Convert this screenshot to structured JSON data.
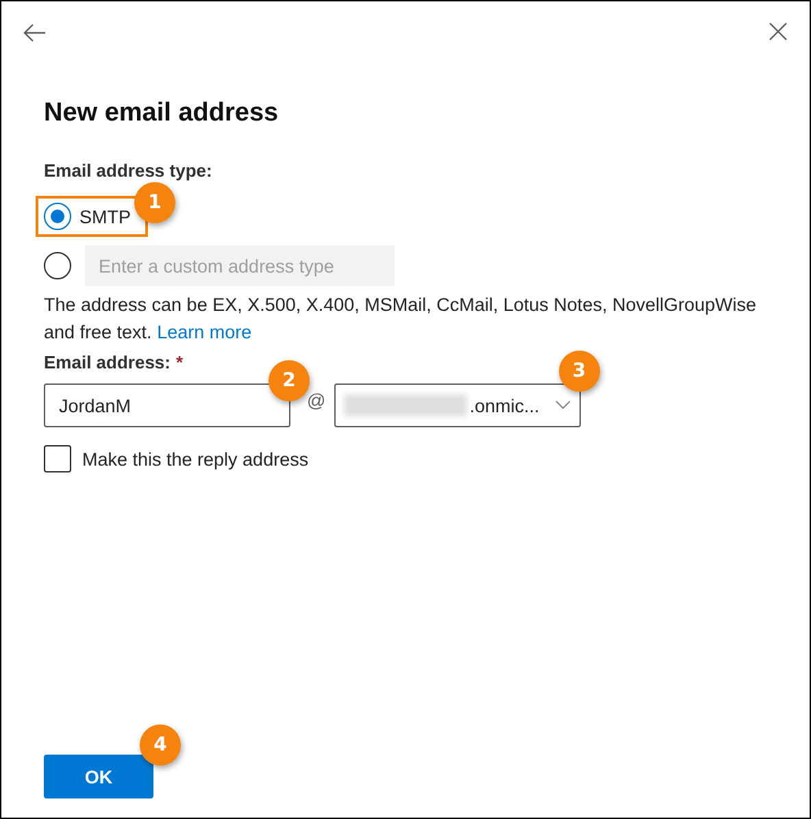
{
  "title": "New email address",
  "address_type": {
    "label": "Email address type:",
    "options": [
      {
        "kind": "fixed",
        "label": "SMTP",
        "selected": true,
        "highlighted": true,
        "callout": "1"
      },
      {
        "kind": "custom",
        "placeholder": "Enter a custom address type",
        "selected": false
      }
    ],
    "help": "The address can be EX, X.500, X.400, MSMail, CcMail, Lotus Notes, NovellGroupWise and free text.",
    "link": "Learn more"
  },
  "email": {
    "label": "Email address:",
    "required_mark": "*",
    "alias": "JordanM",
    "alias_callout": "2",
    "at": "@",
    "domain": ".onmic...",
    "domain_redacted": true,
    "domain_callout": "3"
  },
  "reply_checkbox": {
    "label": "Make this the reply address",
    "checked": false
  },
  "ok_button": {
    "label": "OK",
    "callout": "4"
  }
}
